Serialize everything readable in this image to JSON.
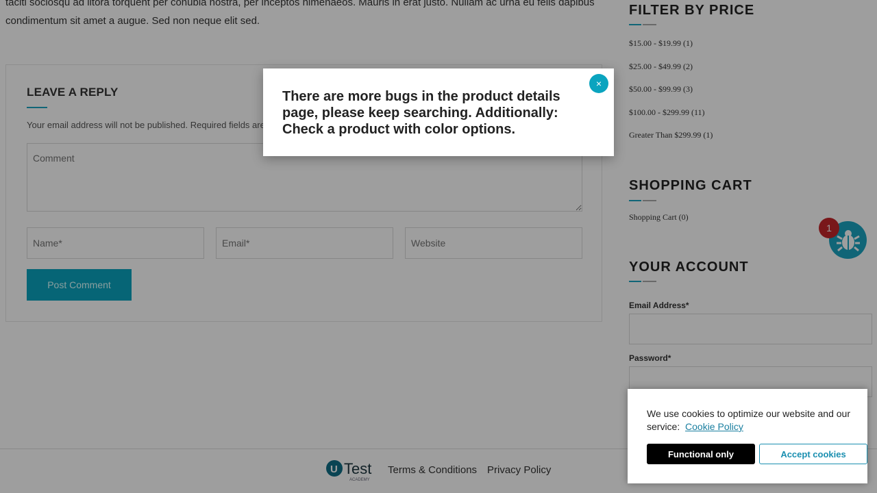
{
  "post": {
    "text": "taciti sociosqu ad litora torquent per conubia nostra, per inceptos himenaeos. Mauris in erat justo. Nullam ac urna eu felis dapibus condimentum sit amet a augue. Sed non neque elit sed."
  },
  "reply": {
    "title": "LEAVE A REPLY",
    "note": "Your email address will not be published. Required fields are marked *",
    "comment_placeholder": "Comment",
    "name_placeholder": "Name*",
    "email_placeholder": "Email*",
    "website_placeholder": "Website",
    "submit_label": "Post Comment"
  },
  "sidebar": {
    "price_title": "FILTER BY PRICE",
    "price_items": [
      "$15.00 - $19.99 (1)",
      "$25.00 - $49.99 (2)",
      "$50.00 - $99.99 (3)",
      "$100.00 - $299.99 (11)",
      "Greater Than $299.99 (1)"
    ],
    "cart_title": "SHOPPING CART",
    "cart_link": "Shopping Cart (0)",
    "account_title": "YOUR ACCOUNT",
    "email_label": "Email Address*",
    "password_label": "Password*"
  },
  "bug_widget": {
    "badge_count": "1",
    "icon": "bug-icon",
    "color": "#1aa3c0"
  },
  "footer": {
    "logo_text": "Test",
    "logo_sub": "ACADEMY",
    "terms": "Terms & Conditions",
    "privacy": "Privacy Policy"
  },
  "modal": {
    "message": "There are more bugs in the product details page, please keep searching. Additionally: Check a product with color options.",
    "close_icon": "close-icon"
  },
  "cookie": {
    "text": "We use cookies to optimize our website and our service:",
    "link": "Cookie Policy",
    "functional": "Functional only",
    "accept": "Accept cookies"
  },
  "colors": {
    "accent": "#0aa4bf",
    "badge": "#c3262a"
  }
}
